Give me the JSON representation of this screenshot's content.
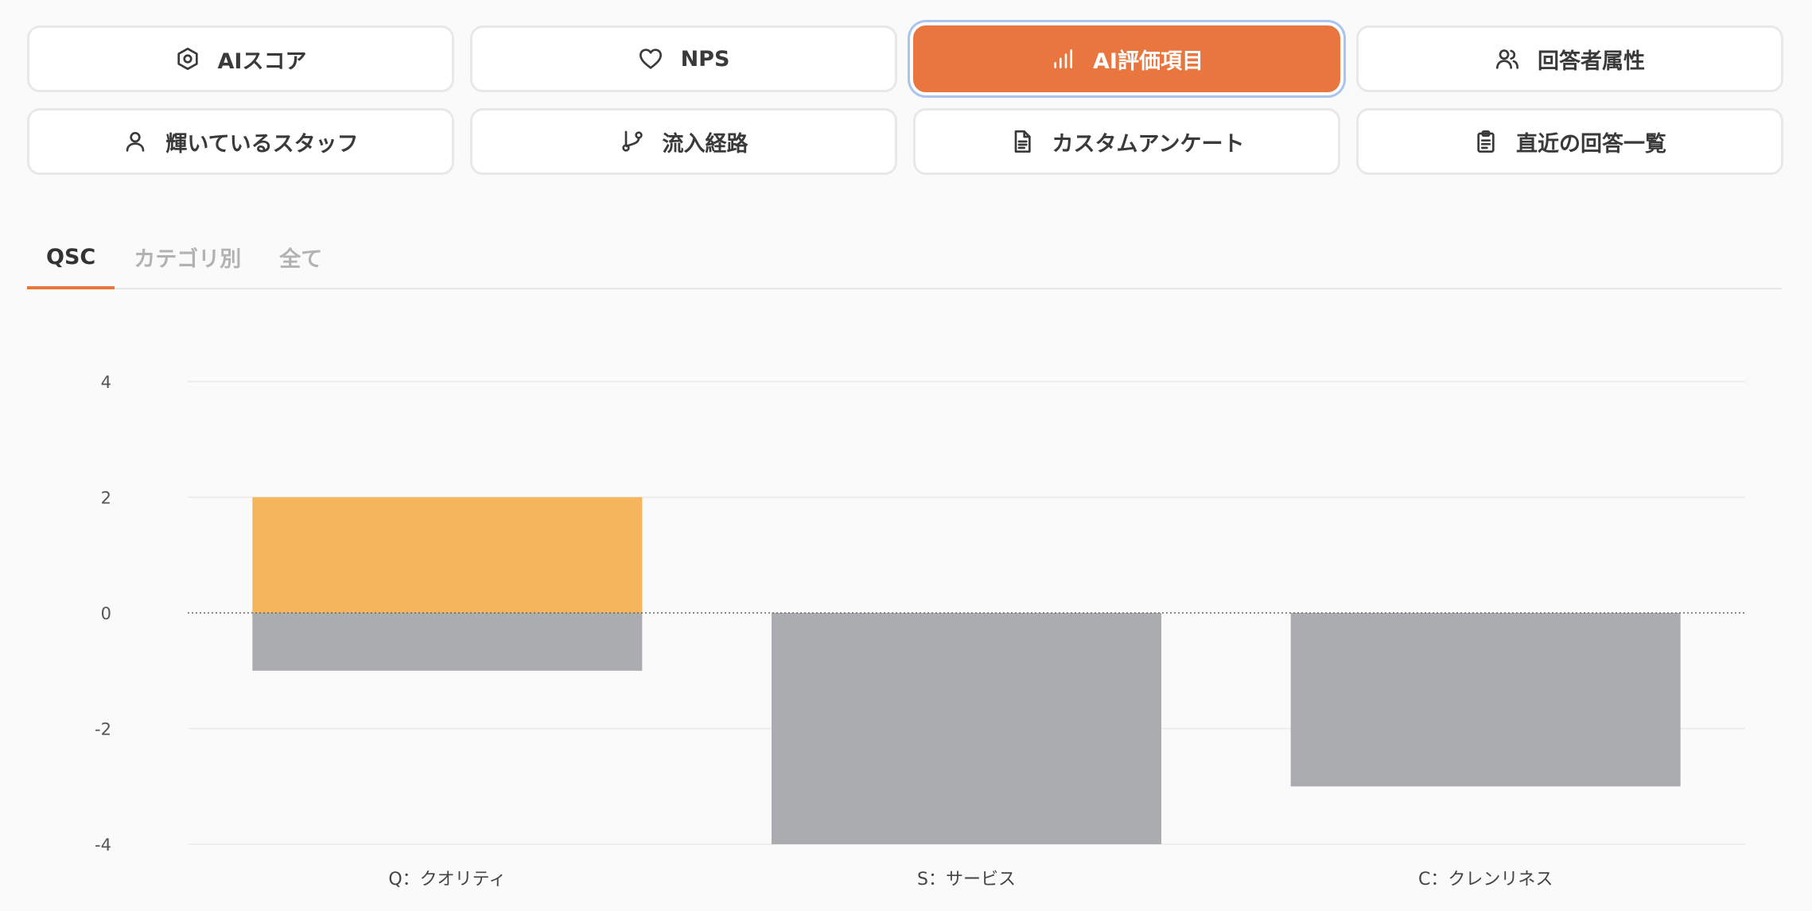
{
  "nav": {
    "buttons": [
      {
        "label": "AIスコア",
        "icon": "hexagon-icon",
        "active": false
      },
      {
        "label": "NPS",
        "icon": "heart-icon",
        "active": false
      },
      {
        "label": "AI評価項目",
        "icon": "bar-chart-icon",
        "active": true
      },
      {
        "label": "回答者属性",
        "icon": "users-icon",
        "active": false
      },
      {
        "label": "輝いているスタッフ",
        "icon": "user-icon",
        "active": false
      },
      {
        "label": "流入経路",
        "icon": "git-branch-icon",
        "active": false
      },
      {
        "label": "カスタムアンケート",
        "icon": "document-icon",
        "active": false
      },
      {
        "label": "直近の回答一覧",
        "icon": "clipboard-icon",
        "active": false
      }
    ]
  },
  "tabs": {
    "items": [
      {
        "label": "QSC",
        "active": true
      },
      {
        "label": "カテゴリ別",
        "active": false
      },
      {
        "label": "全て",
        "active": false
      }
    ]
  },
  "colors": {
    "accent": "#e8763e",
    "positive_bar": "#f4b55c",
    "negative_bar": "#aaacb0",
    "focus_ring": "#a9c4ee"
  },
  "chart_data": {
    "type": "bar",
    "categories": [
      "Q：クオリティ",
      "S：サービス",
      "C：クレンリネス"
    ],
    "series": [
      {
        "values": [
          2,
          0,
          0
        ],
        "color": "#f4b55c"
      },
      {
        "values": [
          -1,
          -4,
          -3
        ],
        "color": "#aaacb0"
      }
    ],
    "stacked": true,
    "ylim": [
      -4,
      4
    ],
    "yticks": [
      4,
      2,
      0,
      -2,
      -4
    ],
    "ytick_labels": [
      "4",
      "2",
      "0",
      "-2",
      "-4"
    ],
    "grid": true,
    "zero_line": "dotted",
    "title": "",
    "xlabel": "",
    "ylabel": ""
  }
}
